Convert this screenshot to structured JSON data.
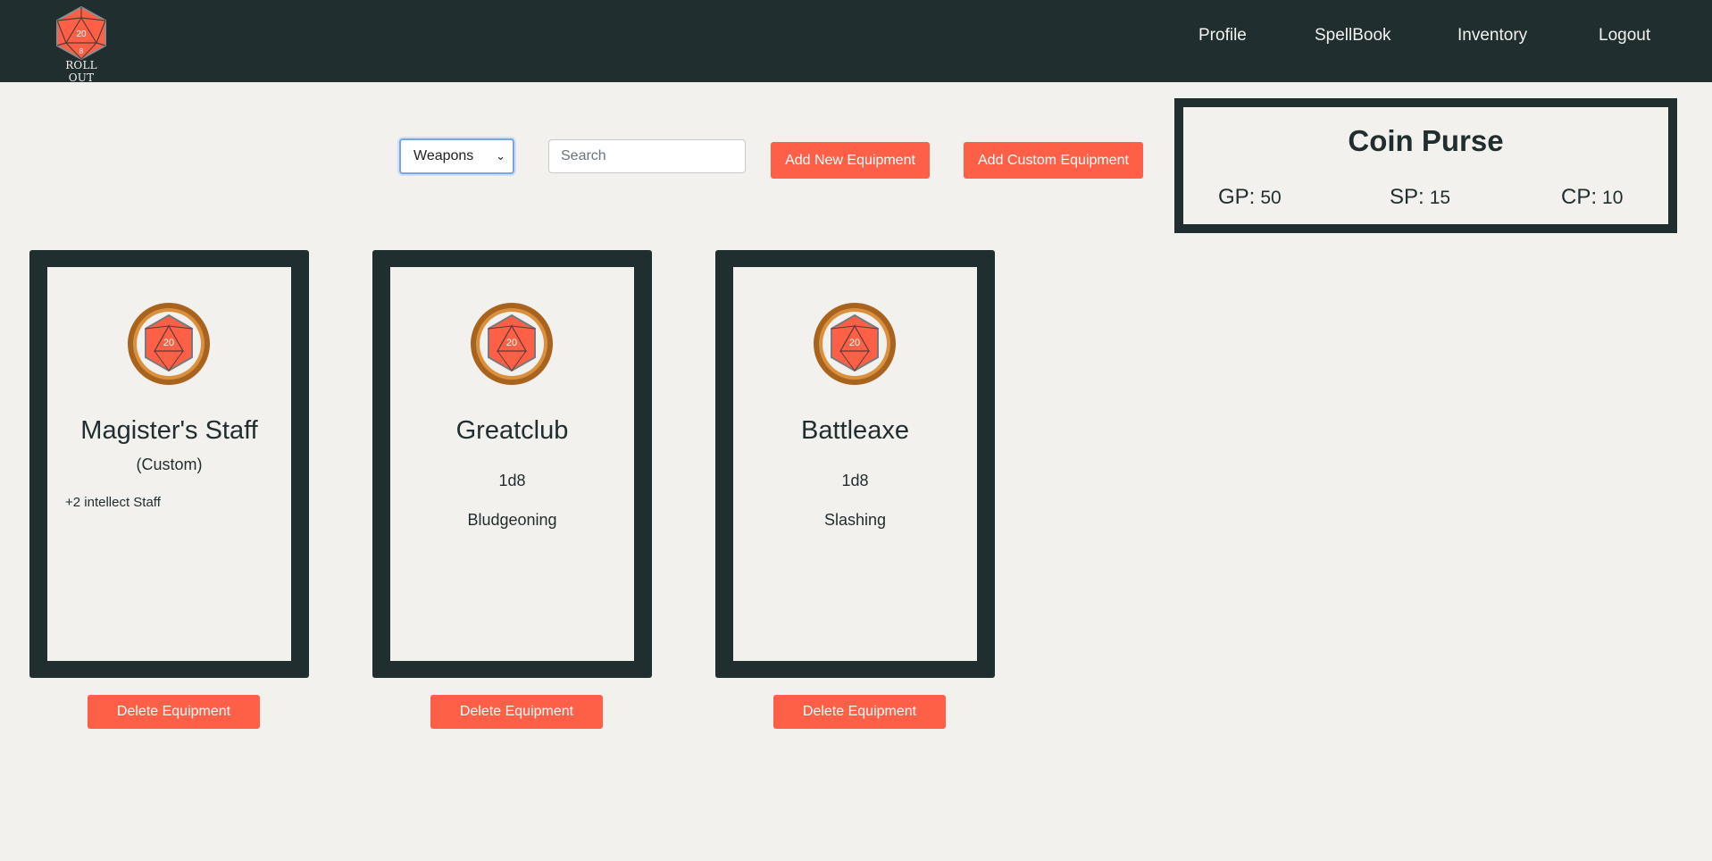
{
  "brand": {
    "logo_text": "ROLL OUT",
    "accent": "#fe5f47",
    "dark": "#212e2f",
    "background": "#f3f1ed"
  },
  "nav": {
    "profile": "Profile",
    "spellbook": "SpellBook",
    "inventory": "Inventory",
    "logout": "Logout"
  },
  "toolbar": {
    "category": "Weapons",
    "search_placeholder": "Search",
    "add_new_label": "Add New Equipment",
    "add_custom_label": "Add Custom Equipment"
  },
  "coin_purse": {
    "title": "Coin Purse",
    "gp_label": "GP:",
    "gp": "50",
    "sp_label": "SP:",
    "sp": "15",
    "cp_label": "CP:",
    "cp": "10"
  },
  "cards": [
    {
      "name": "Magister's Staff",
      "subtitle": "(Custom)",
      "description": "+2 intellect Staff",
      "delete_label": "Delete Equipment"
    },
    {
      "name": "Greatclub",
      "damage": "1d8",
      "damage_type": "Bludgeoning",
      "delete_label": "Delete Equipment"
    },
    {
      "name": "Battleaxe",
      "damage": "1d8",
      "damage_type": "Slashing",
      "delete_label": "Delete Equipment"
    }
  ]
}
